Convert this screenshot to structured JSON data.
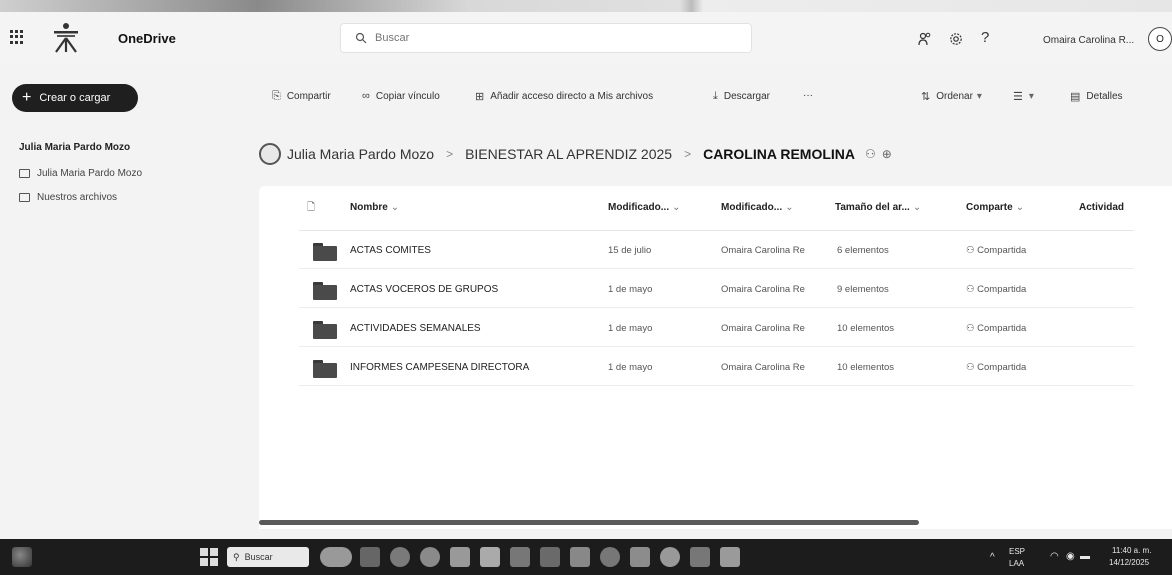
{
  "header": {
    "app_name": "OneDrive",
    "search_placeholder": "Buscar",
    "user_name": "Omaira Carolina R...",
    "avatar_initial": "O",
    "icons": [
      "app-launcher-icon",
      "contacts-icon",
      "settings-icon",
      "help-icon"
    ]
  },
  "sidebar": {
    "create_label": "Crear o cargar",
    "owner": "Julia Maria Pardo Mozo",
    "items": [
      {
        "label": "Julia Maria Pardo Mozo",
        "icon": "folder-icon"
      },
      {
        "label": "Nuestros archivos",
        "icon": "shared-folder-icon"
      }
    ]
  },
  "commands": {
    "share": "Compartir",
    "copy_link": "Copiar vínculo",
    "add_shortcut": "Añadir acceso directo a Mis archivos",
    "download": "Descargar",
    "more": "···",
    "sort": "Ordenar",
    "details": "Detalles"
  },
  "breadcrumb": {
    "items": [
      "Julia Maria Pardo Mozo",
      "BIENESTAR AL APRENDIZ 2025",
      "CAROLINA REMOLINA"
    ],
    "separator": ">"
  },
  "table": {
    "columns": [
      "Nombre",
      "Modificado...",
      "Modificado...",
      "Tamaño del ar...",
      "Comparte",
      "Actividad"
    ],
    "rows": [
      {
        "name": "ACTAS COMITES",
        "modified": "15 de julio",
        "modified_by": "Omaira Carolina Re",
        "size": "6 elementos",
        "sharing": "Compartida"
      },
      {
        "name": "ACTAS VOCEROS DE GRUPOS",
        "modified": "1 de mayo",
        "modified_by": "Omaira Carolina Re",
        "size": "9 elementos",
        "sharing": "Compartida"
      },
      {
        "name": "ACTIVIDADES SEMANALES",
        "modified": "1 de mayo",
        "modified_by": "Omaira Carolina Re",
        "size": "10 elementos",
        "sharing": "Compartida"
      },
      {
        "name": "INFORMES CAMPESENA DIRECTORA",
        "modified": "1 de mayo",
        "modified_by": "Omaira Carolina Re",
        "size": "10 elementos",
        "sharing": "Compartida"
      }
    ]
  },
  "taskbar": {
    "search_placeholder": "Buscar",
    "lang": "ESP",
    "lang_sub": "LAA",
    "time": "11:40 a. m.",
    "date": "14/12/2025"
  }
}
